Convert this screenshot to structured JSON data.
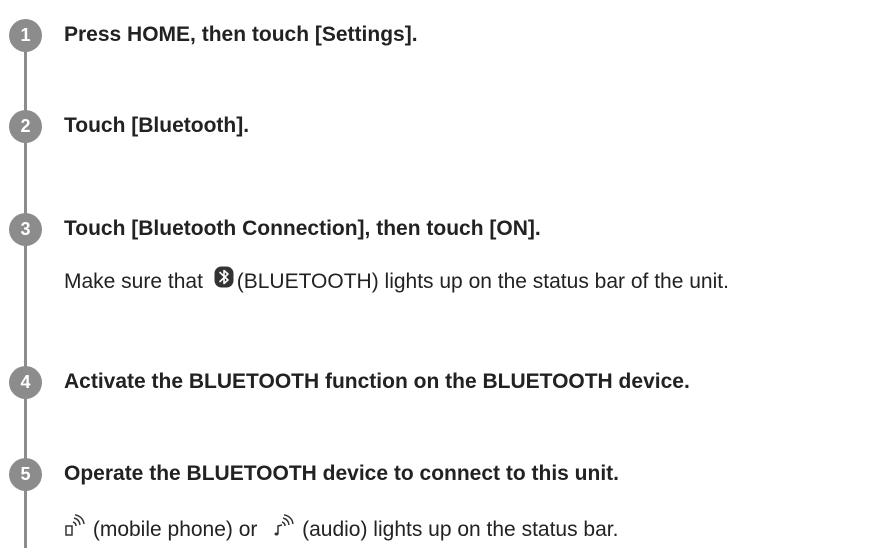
{
  "steps": [
    {
      "number": "1",
      "title": "Press HOME, then touch [Settings]."
    },
    {
      "number": "2",
      "title": "Touch [Bluetooth]."
    },
    {
      "number": "3",
      "title": "Touch [Bluetooth Connection], then touch [ON].",
      "note": {
        "prefix": "Make sure that ",
        "icon": "bluetooth-icon",
        "suffix": "(BLUETOOTH) lights up on the status bar of the unit."
      }
    },
    {
      "number": "4",
      "title": "Activate the BLUETOOTH function on the BLUETOOTH device."
    },
    {
      "number": "5",
      "title": "Operate the BLUETOOTH device to connect to this unit.",
      "note": {
        "icon1": "mobile-phone-icon",
        "part1": " (mobile phone) or ",
        "icon2": "audio-icon",
        "part2": " (audio) lights up on the status bar."
      }
    }
  ],
  "colors": {
    "badge": "#8c8c8c",
    "line": "#8c8c8c",
    "text": "#222222"
  }
}
